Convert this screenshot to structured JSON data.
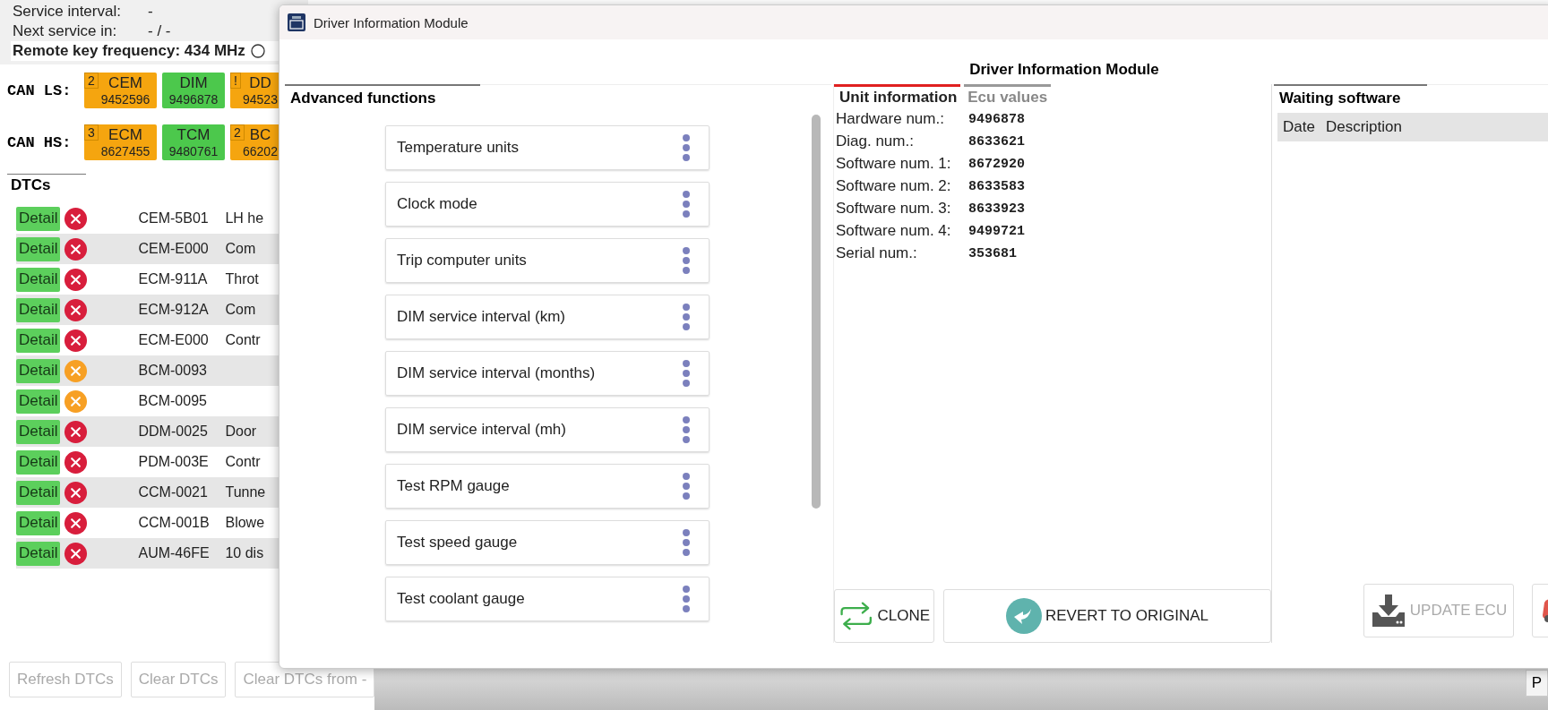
{
  "vehicle_info": {
    "service_interval_label": "Service interval:",
    "service_interval_value": "-",
    "next_service_label": "Next service in:",
    "next_service_value": "- / -",
    "remote_key": "Remote key frequency: 434 MHz"
  },
  "buses": [
    {
      "label": "CAN LS:",
      "modules": [
        {
          "name": "CEM",
          "number": "9452596",
          "badge": "2",
          "color": "#f5a50f"
        },
        {
          "name": "DIM",
          "number": "9496878",
          "color": "#4cc84c"
        },
        {
          "name": "DD",
          "number": "94523",
          "badge": "!",
          "color": "#f5a50f"
        }
      ]
    },
    {
      "label": "CAN HS:",
      "modules": [
        {
          "name": "ECM",
          "number": "8627455",
          "badge": "3",
          "color": "#f5a50f"
        },
        {
          "name": "TCM",
          "number": "9480761",
          "color": "#4cc84c"
        },
        {
          "name": "BC",
          "number": "66202",
          "badge": "2",
          "color": "#f5a50f"
        }
      ]
    }
  ],
  "dtc_tab": "DTCs",
  "dtcs": [
    {
      "button": "Detail",
      "color": "#d81e3c",
      "code": "CEM-5B01",
      "description": "LH he"
    },
    {
      "button": "Detail",
      "color": "#d81e3c",
      "code": "CEM-E000",
      "description": "Com"
    },
    {
      "button": "Detail",
      "color": "#d81e3c",
      "code": "ECM-911A",
      "description": "Throt"
    },
    {
      "button": "Detail",
      "color": "#d81e3c",
      "code": "ECM-912A",
      "description": "Com"
    },
    {
      "button": "Detail",
      "color": "#d81e3c",
      "code": "ECM-E000",
      "description": "Contr"
    },
    {
      "button": "Detail",
      "color": "#f7a024",
      "code": "BCM-0093"
    },
    {
      "button": "Detail",
      "color": "#f7a024",
      "code": "BCM-0095"
    },
    {
      "button": "Detail",
      "color": "#d81e3c",
      "code": "DDM-0025",
      "description": "Door"
    },
    {
      "button": "Detail",
      "color": "#d81e3c",
      "code": "PDM-003E",
      "description": "Contr"
    },
    {
      "button": "Detail",
      "color": "#d81e3c",
      "code": "CCM-0021",
      "description": "Tunne"
    },
    {
      "button": "Detail",
      "color": "#d81e3c",
      "code": "CCM-001B",
      "description": "Blowe"
    },
    {
      "button": "Detail",
      "color": "#d81e3c",
      "code": "AUM-46FE",
      "description": "10 dis"
    }
  ],
  "dtc_buttons": [
    {
      "label": "Refresh DTCs",
      "disabled": true
    },
    {
      "label": "Clear DTCs",
      "disabled": true
    },
    {
      "label": "Clear DTCs from -",
      "disabled": true
    }
  ],
  "status_bar": {
    "button": "P"
  },
  "dialog": {
    "title": "Driver Information Module",
    "heading": "Driver Information Module",
    "advanced_functions": {
      "title": "Advanced functions",
      "items": [
        "Temperature units",
        "Clock mode",
        "Trip computer units",
        "DIM service interval (km)",
        "DIM service interval (months)",
        "DIM service interval (mh)",
        "Test RPM gauge",
        "Test speed gauge",
        "Test coolant gauge"
      ]
    },
    "tabs": [
      {
        "label": "Unit information",
        "selected": true
      },
      {
        "label": "Ecu values",
        "selected": false
      }
    ],
    "unit_info": [
      {
        "label": "Hardware num.:",
        "value": "9496878"
      },
      {
        "label": "Diag. num.:",
        "value": "8633621"
      },
      {
        "label": "Software num. 1:",
        "value": "8672920"
      },
      {
        "label": "Software num. 2:",
        "value": "8633583"
      },
      {
        "label": "Software num. 3:",
        "value": "8633923"
      },
      {
        "label": "Software num. 4:",
        "value": "9499721"
      },
      {
        "label": "Serial num.:",
        "value": "353681"
      }
    ],
    "clone_button": "CLONE",
    "revert_button": "REVERT TO ORIGINAL",
    "waiting_software": {
      "title": "Waiting software",
      "columns": [
        "Date",
        "Description"
      ]
    },
    "update_button": {
      "label": "UPDATE ECU",
      "disabled": true
    }
  }
}
